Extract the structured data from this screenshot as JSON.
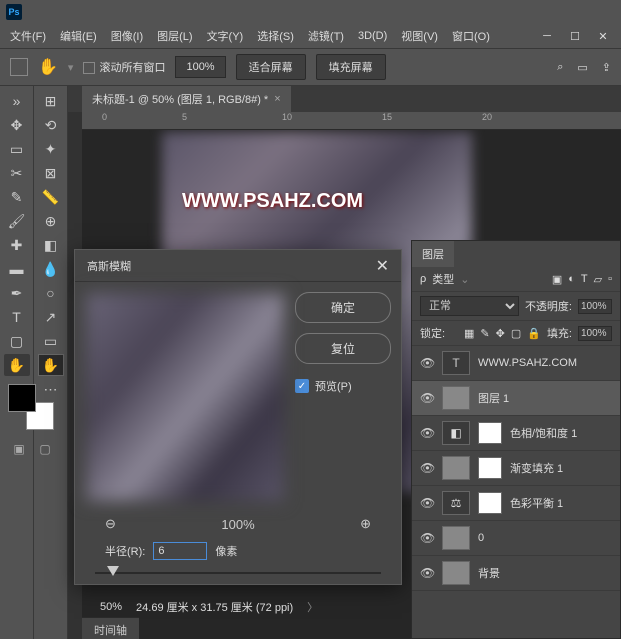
{
  "menu": {
    "file": "文件(F)",
    "edit": "编辑(E)",
    "image": "图像(I)",
    "layer": "图层(L)",
    "type": "文字(Y)",
    "select": "选择(S)",
    "filter": "滤镜(T)",
    "d3": "3D(D)",
    "view": "视图(V)",
    "window": "窗口(O)"
  },
  "optbar": {
    "scroll": "滚动所有窗口",
    "zoom": "100%",
    "fit": "适合屏幕",
    "fill": "填充屏幕"
  },
  "tab": {
    "title": "未标题-1 @ 50% (图层 1, RGB/8#) *"
  },
  "watermark": "WWW.PSAHZ.COM",
  "dialog": {
    "title": "高斯模糊",
    "ok": "确定",
    "reset": "复位",
    "preview": "预览(P)",
    "zoom": "100%",
    "radius_label": "半径(R):",
    "radius_value": "6",
    "px": "像素"
  },
  "status": {
    "zoom": "50%",
    "dim": "24.69 厘米 x 31.75 厘米 (72 ppi)"
  },
  "timeline": "时间轴",
  "layers_panel": {
    "tab": "图层",
    "kind": "类型",
    "blend": "正常",
    "opacity_label": "不透明度:",
    "opacity": "100%",
    "lock": "锁定:",
    "fill_label": "填充:",
    "fill": "100%",
    "items": [
      {
        "name": "WWW.PSAHZ.COM",
        "type": "T"
      },
      {
        "name": "图层 1",
        "type": "img",
        "sel": true
      },
      {
        "name": "色相/饱和度 1",
        "type": "adj"
      },
      {
        "name": "渐变填充 1",
        "type": "grad"
      },
      {
        "name": "色彩平衡 1",
        "type": "bal"
      },
      {
        "name": "0",
        "type": "img2"
      },
      {
        "name": "背景",
        "type": "bg"
      }
    ]
  }
}
